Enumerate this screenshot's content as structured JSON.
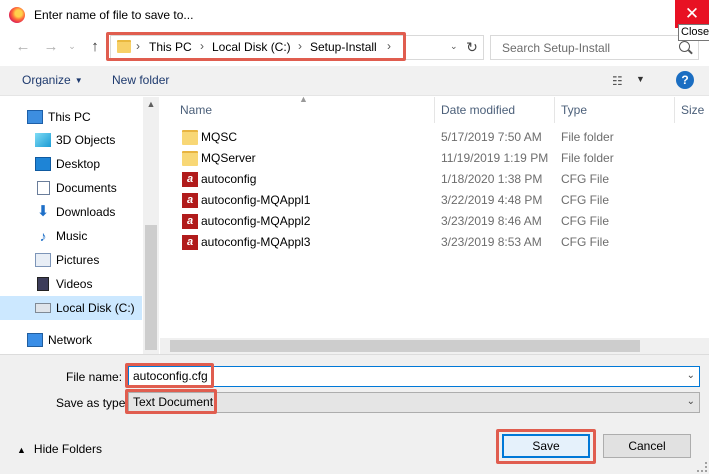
{
  "window": {
    "title": "Enter name of file to save to...",
    "close_glyph": "✕",
    "close_tooltip": "Close"
  },
  "nav": {
    "back": "←",
    "forward": "→",
    "up": "↑"
  },
  "address": {
    "crumbs": [
      "This PC",
      "Local Disk (C:)",
      "Setup-Install"
    ],
    "sep": "›",
    "refresh": "↻"
  },
  "search": {
    "placeholder": "Search Setup-Install"
  },
  "toolbar": {
    "organize": "Organize",
    "new_folder": "New folder",
    "help": "?"
  },
  "sidebar": {
    "items": [
      {
        "label": "This PC",
        "icon": "computer-icon"
      },
      {
        "label": "3D Objects",
        "icon": "cube-icon"
      },
      {
        "label": "Desktop",
        "icon": "desktop-icon"
      },
      {
        "label": "Documents",
        "icon": "document-icon"
      },
      {
        "label": "Downloads",
        "icon": "download-icon"
      },
      {
        "label": "Music",
        "icon": "music-icon"
      },
      {
        "label": "Pictures",
        "icon": "pictures-icon"
      },
      {
        "label": "Videos",
        "icon": "videos-icon"
      },
      {
        "label": "Local Disk (C:)",
        "icon": "disk-icon",
        "selected": true
      },
      {
        "label": "Network",
        "icon": "network-icon"
      }
    ]
  },
  "columns": {
    "name": "Name",
    "date": "Date modified",
    "type": "Type",
    "size": "Size"
  },
  "files": [
    {
      "name": "MQSC",
      "date": "5/17/2019 7:50 AM",
      "type": "File folder",
      "kind": "folder"
    },
    {
      "name": "MQServer",
      "date": "11/19/2019 1:19 PM",
      "type": "File folder",
      "kind": "folder"
    },
    {
      "name": "autoconfig",
      "date": "1/18/2020 1:38 PM",
      "type": "CFG File",
      "kind": "cfg"
    },
    {
      "name": "autoconfig-MQAppl1",
      "date": "3/22/2019 4:48 PM",
      "type": "CFG File",
      "kind": "cfg"
    },
    {
      "name": "autoconfig-MQAppl2",
      "date": "3/23/2019 8:46 AM",
      "type": "CFG File",
      "kind": "cfg"
    },
    {
      "name": "autoconfig-MQAppl3",
      "date": "3/23/2019 8:53 AM",
      "type": "CFG File",
      "kind": "cfg"
    }
  ],
  "form": {
    "file_name_label": "File name:",
    "file_name_value": "autoconfig.cfg",
    "save_type_label": "Save as type:",
    "save_type_value": "Text Document"
  },
  "footer": {
    "hide_folders": "Hide Folders",
    "save": "Save",
    "cancel": "Cancel"
  },
  "colors": {
    "highlight": "#e05d4f",
    "selection": "#cce8ff",
    "accent": "#0078d7",
    "close": "#e81123"
  }
}
